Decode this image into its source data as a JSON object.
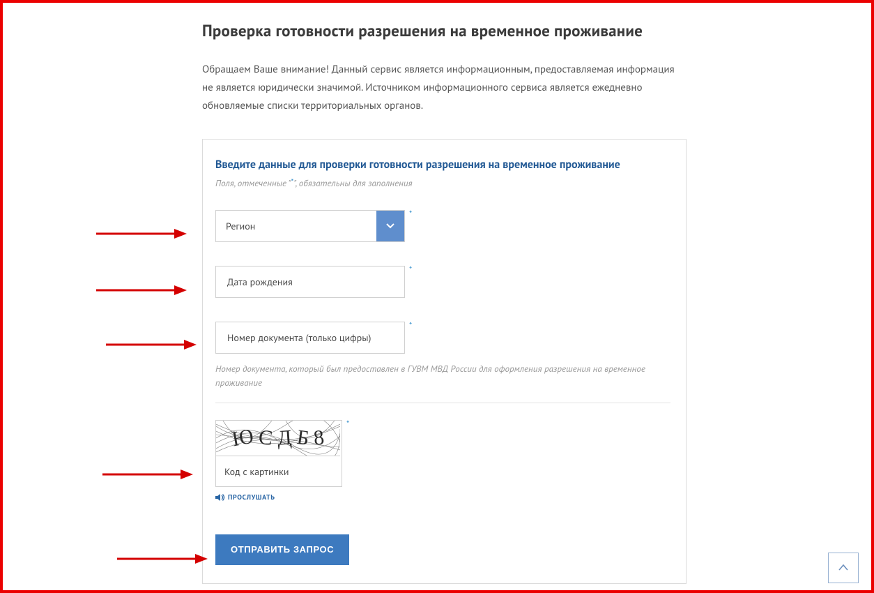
{
  "page": {
    "title": "Проверка готовности разрешения на временное проживание",
    "intro": "Обращаем Ваше внимание! Данный сервис является информационным, предоставляемая информация не является юридически значимой. Источником информационного сервиса является ежедневно обновляемые списки территориальных органов."
  },
  "form": {
    "heading": "Введите данные для проверки готовности разрешения на временное проживание",
    "required_hint_pre": "Поля, отмеченные \"",
    "required_mark": "*",
    "required_hint_post": "\", обязательны для заполнения",
    "region_placeholder": "Регион",
    "dob_placeholder": "Дата рождения",
    "docnum_placeholder": "Номер документа (только цифры)",
    "docnum_hint": "Номер документа, который был предоставлен в ГУВМ МВД России для оформления разрешения на временное проживание",
    "captcha_placeholder": "Код с картинки",
    "captcha_chars": [
      "Ю",
      "С",
      "Д",
      "Б",
      "8"
    ],
    "listen_label": "ПРОСЛУШАТЬ",
    "submit_label": "ОТПРАВИТЬ ЗАПРОС",
    "star": "*"
  }
}
